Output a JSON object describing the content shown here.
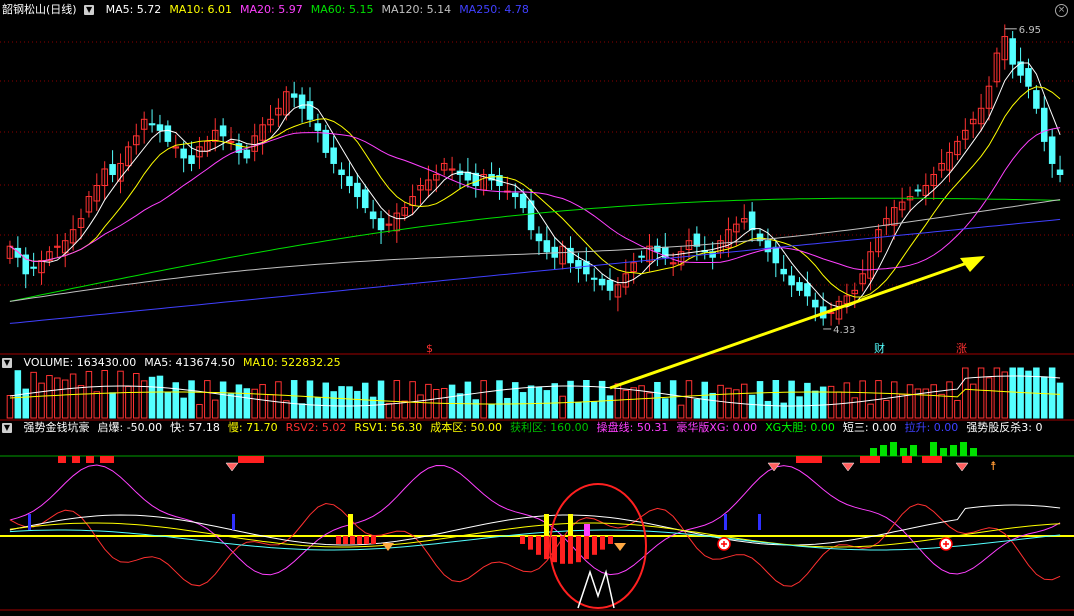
{
  "price_header": {
    "title": "韶钢松山(日线)",
    "items": [
      {
        "label": "MA5: 5.72",
        "color": "#ffffff"
      },
      {
        "label": "MA10: 6.01",
        "color": "#ffff00"
      },
      {
        "label": "MA20: 5.97",
        "color": "#ff40ff"
      },
      {
        "label": "MA60: 5.15",
        "color": "#00e000"
      },
      {
        "label": "MA120: 5.14",
        "color": "#c0c0c0"
      },
      {
        "label": "MA250: 4.78",
        "color": "#4040ff"
      }
    ]
  },
  "volume_header": {
    "items": [
      {
        "label": "VOLUME: 163430.00",
        "color": "#ffffff"
      },
      {
        "label": "MA5: 413674.50",
        "color": "#ffffff"
      },
      {
        "label": "MA10: 522832.25",
        "color": "#ffff00"
      }
    ]
  },
  "indicator_header": {
    "items": [
      {
        "label": "强势金钱坑豪",
        "color": "#ffffff"
      },
      {
        "label": "启爆: -50.00",
        "color": "#ffffff"
      },
      {
        "label": "快: 57.18",
        "color": "#ffffff"
      },
      {
        "label": "慢: 71.70",
        "color": "#ffff00"
      },
      {
        "label": "RSV2: 5.02",
        "color": "#ff3030"
      },
      {
        "label": "RSV1: 56.30",
        "color": "#ffff00"
      },
      {
        "label": "成本区: 50.00",
        "color": "#ffff00"
      },
      {
        "label": "获利区: 160.00",
        "color": "#00c000"
      },
      {
        "label": "操盘线: 50.31",
        "color": "#ff40ff"
      },
      {
        "label": "豪华版XG: 0.00",
        "color": "#ff40ff"
      },
      {
        "label": "XG大胆: 0.00",
        "color": "#00ff00"
      },
      {
        "label": "短三: 0.00",
        "color": "#ffffff"
      },
      {
        "label": "拉升: 0.00",
        "color": "#4040ff"
      },
      {
        "label": "强势股反杀3: 0",
        "color": "#ffffff"
      }
    ]
  },
  "annotations": {
    "high_label": "6.95",
    "low_label": "4.33",
    "marker_s": "$",
    "marker_cai": "财",
    "marker_zhang": "涨"
  },
  "colors": {
    "up": "#ff3232",
    "down": "#54ffff",
    "arrow": "#ffff00",
    "grid": "#8b0000"
  },
  "chart_data": {
    "type": "candlestick",
    "close": [
      5.05,
      4.95,
      4.8,
      4.85,
      4.92,
      5.0,
      5.05,
      5.1,
      5.2,
      5.3,
      5.5,
      5.6,
      5.75,
      5.7,
      5.8,
      5.95,
      6.05,
      6.2,
      6.15,
      6.1,
      6.0,
      5.95,
      5.85,
      5.8,
      5.95,
      6.0,
      6.1,
      6.05,
      6.0,
      5.9,
      5.85,
      6.05,
      6.15,
      6.2,
      6.3,
      6.45,
      6.4,
      6.3,
      6.2,
      6.1,
      5.9,
      5.8,
      5.7,
      5.6,
      5.5,
      5.4,
      5.3,
      5.2,
      5.25,
      5.35,
      5.4,
      5.5,
      5.6,
      5.65,
      5.7,
      5.8,
      5.75,
      5.7,
      5.65,
      5.6,
      5.7,
      5.65,
      5.6,
      5.55,
      5.5,
      5.4,
      5.2,
      5.1,
      5.0,
      4.95,
      5.05,
      4.9,
      4.85,
      4.8,
      4.75,
      4.7,
      4.65,
      4.7,
      4.8,
      4.9,
      4.95,
      5.05,
      5.0,
      4.95,
      4.9,
      5.0,
      5.1,
      5.05,
      5.0,
      4.95,
      5.1,
      5.2,
      5.25,
      5.3,
      5.2,
      5.1,
      5.0,
      4.9,
      4.8,
      4.7,
      4.65,
      4.6,
      4.5,
      4.4,
      4.45,
      4.55,
      4.6,
      4.65,
      4.8,
      5.0,
      5.2,
      5.3,
      5.4,
      5.45,
      5.5,
      5.55,
      5.6,
      5.7,
      5.8,
      5.9,
      6.0,
      6.1,
      6.2,
      6.3,
      6.5,
      6.8,
      6.95,
      6.7,
      6.6,
      6.5,
      6.3,
      6.0,
      5.8,
      5.7
    ],
    "series": [
      {
        "name": "MA5"
      },
      {
        "name": "MA10"
      },
      {
        "name": "MA20"
      },
      {
        "name": "MA60"
      },
      {
        "name": "MA120"
      },
      {
        "name": "MA250"
      }
    ]
  }
}
